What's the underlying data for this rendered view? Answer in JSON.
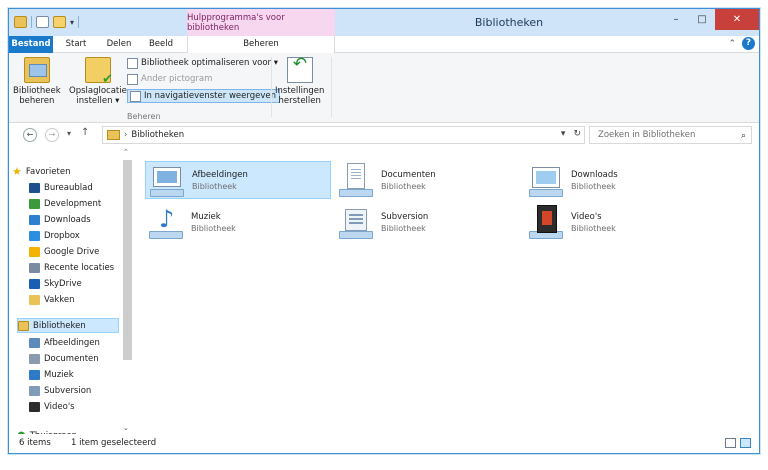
{
  "window": {
    "title": "Bibliotheken",
    "contextual_group": "Hulpprogramma's voor bibliotheken"
  },
  "controls": {
    "minimize": "–",
    "maximize": "□",
    "close": "✕"
  },
  "ribbon_tabs": {
    "file": "Bestand",
    "start": "Start",
    "share": "Delen",
    "view": "Beeld",
    "manage": "Beheren"
  },
  "ribbon": {
    "manage_library": [
      "Bibliotheek",
      "beheren"
    ],
    "set_save_location": [
      "Opslaglocatie",
      "instellen ▾"
    ],
    "optimize": "Bibliotheek optimaliseren voor ▾",
    "change_icon": "Ander pictogram",
    "show_in_nav": "In navigatievenster weergeven",
    "restore_settings": [
      "Instellingen",
      "herstellen"
    ],
    "group_label": "Beheren"
  },
  "address": {
    "path": "Bibliotheken",
    "search_placeholder": "Zoeken in Bibliotheken"
  },
  "nav": {
    "favorites_header": "Favorieten",
    "favorites": [
      {
        "label": "Bureaublad",
        "color": "#1f4e8c"
      },
      {
        "label": "Development",
        "color": "#3c9a3c"
      },
      {
        "label": "Downloads",
        "color": "#2f7fd0"
      },
      {
        "label": "Dropbox",
        "color": "#2b8ee0"
      },
      {
        "label": "Google Drive",
        "color": "#f2b400"
      },
      {
        "label": "Recente locaties",
        "color": "#7a8aa0"
      },
      {
        "label": "SkyDrive",
        "color": "#1b5fb4"
      },
      {
        "label": "Vakken",
        "color": "#e9c35a"
      }
    ],
    "libraries_header": "Bibliotheken",
    "libraries": [
      {
        "label": "Afbeeldingen",
        "color": "#5c8cbe"
      },
      {
        "label": "Documenten",
        "color": "#8a9bb0"
      },
      {
        "label": "Muziek",
        "color": "#2d7ac8"
      },
      {
        "label": "Subversion",
        "color": "#7f9bb8"
      },
      {
        "label": "Video's",
        "color": "#2c2c2c"
      }
    ],
    "homegroup": "Thuisgroep"
  },
  "content": {
    "libraries": [
      {
        "name": "Afbeeldingen",
        "type": "Bibliotheek",
        "icon": "pictures-library-icon",
        "selected": true
      },
      {
        "name": "Documenten",
        "type": "Bibliotheek",
        "icon": "documents-library-icon",
        "selected": false
      },
      {
        "name": "Downloads",
        "type": "Bibliotheek",
        "icon": "downloads-library-icon",
        "selected": false
      },
      {
        "name": "Muziek",
        "type": "Bibliotheek",
        "icon": "music-library-icon",
        "selected": false
      },
      {
        "name": "Subversion",
        "type": "Bibliotheek",
        "icon": "subversion-library-icon",
        "selected": false
      },
      {
        "name": "Video's",
        "type": "Bibliotheek",
        "icon": "videos-library-icon",
        "selected": false
      }
    ]
  },
  "status": {
    "count": "6 items",
    "selection": "1 item geselecteerd"
  },
  "colors": {
    "accent": "#1979ca",
    "selection_bg": "#cce8ff",
    "selection_border": "#99d1ff",
    "context_tab": "#f7d7ef",
    "close_button": "#c7403b"
  }
}
